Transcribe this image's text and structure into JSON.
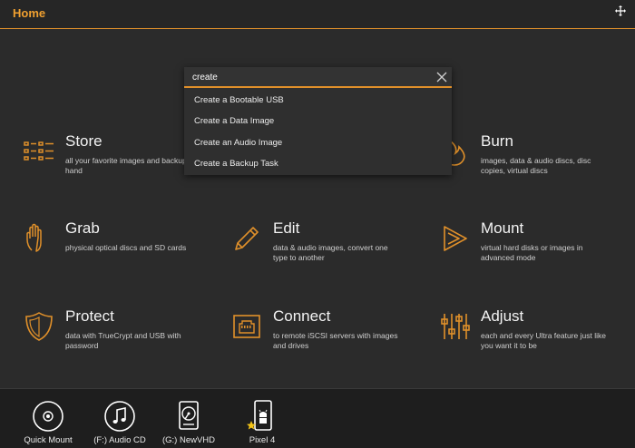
{
  "header": {
    "title": "Home"
  },
  "colors": {
    "accent": "#e0902a",
    "background": "#2b2b2b",
    "dock": "#1e1e1e"
  },
  "search": {
    "value": "create",
    "suggestions": [
      "Create a Bootable USB",
      "Create a Data Image",
      "Create an Audio Image",
      "Create a Backup Task"
    ]
  },
  "tiles": {
    "store": {
      "title": "Store",
      "desc": "all your favorite images and backup hand",
      "icon": "list-icon"
    },
    "burn": {
      "title": "Burn",
      "desc": "images, data & audio discs, disc copies, virtual discs",
      "icon": "flame-icon"
    },
    "grab": {
      "title": "Grab",
      "desc": "physical optical discs and SD cards",
      "icon": "hand-icon"
    },
    "edit": {
      "title": "Edit",
      "desc": "data & audio images, convert one type to another",
      "icon": "pencil-icon"
    },
    "mount": {
      "title": "Mount",
      "desc": "virtual hard disks or images in advanced mode",
      "icon": "play-icon"
    },
    "protect": {
      "title": "Protect",
      "desc": "data with TrueCrypt and USB with password",
      "icon": "shield-icon"
    },
    "connect": {
      "title": "Connect",
      "desc": "to remote iSCSI servers with images and drives",
      "icon": "network-port-icon"
    },
    "adjust": {
      "title": "Adjust",
      "desc": "each and every Ultra feature just like you want it to be",
      "icon": "sliders-icon"
    }
  },
  "dock": {
    "items": [
      {
        "label": "Quick Mount",
        "icon": "disc-icon"
      },
      {
        "label": "(F:) Audio CD",
        "icon": "music-note-icon"
      },
      {
        "label": "(G:) NewVHD",
        "icon": "hard-drive-icon"
      },
      {
        "label": "Pixel 4",
        "icon": "android-phone-icon"
      }
    ]
  }
}
